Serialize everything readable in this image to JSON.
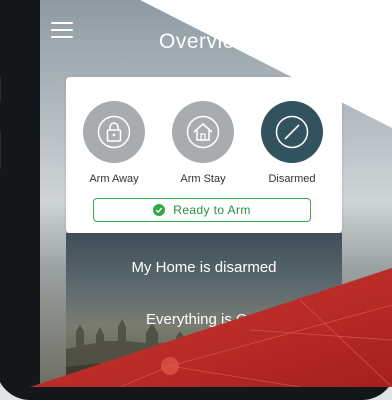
{
  "header": {
    "title": "Overview"
  },
  "modes": [
    {
      "label": "Arm Away",
      "icon": "lock-icon"
    },
    {
      "label": "Arm Stay",
      "icon": "home-icon"
    },
    {
      "label": "Disarmed",
      "icon": "disarmed-icon"
    }
  ],
  "ready": {
    "label": "Ready to Arm"
  },
  "status": {
    "line1": "My Home is disarmed",
    "line2": "Everything is O"
  },
  "colors": {
    "active": "#32535e",
    "inactive": "#a9acae",
    "ready_green": "#3cab47",
    "red_accent": "#c62a29"
  }
}
